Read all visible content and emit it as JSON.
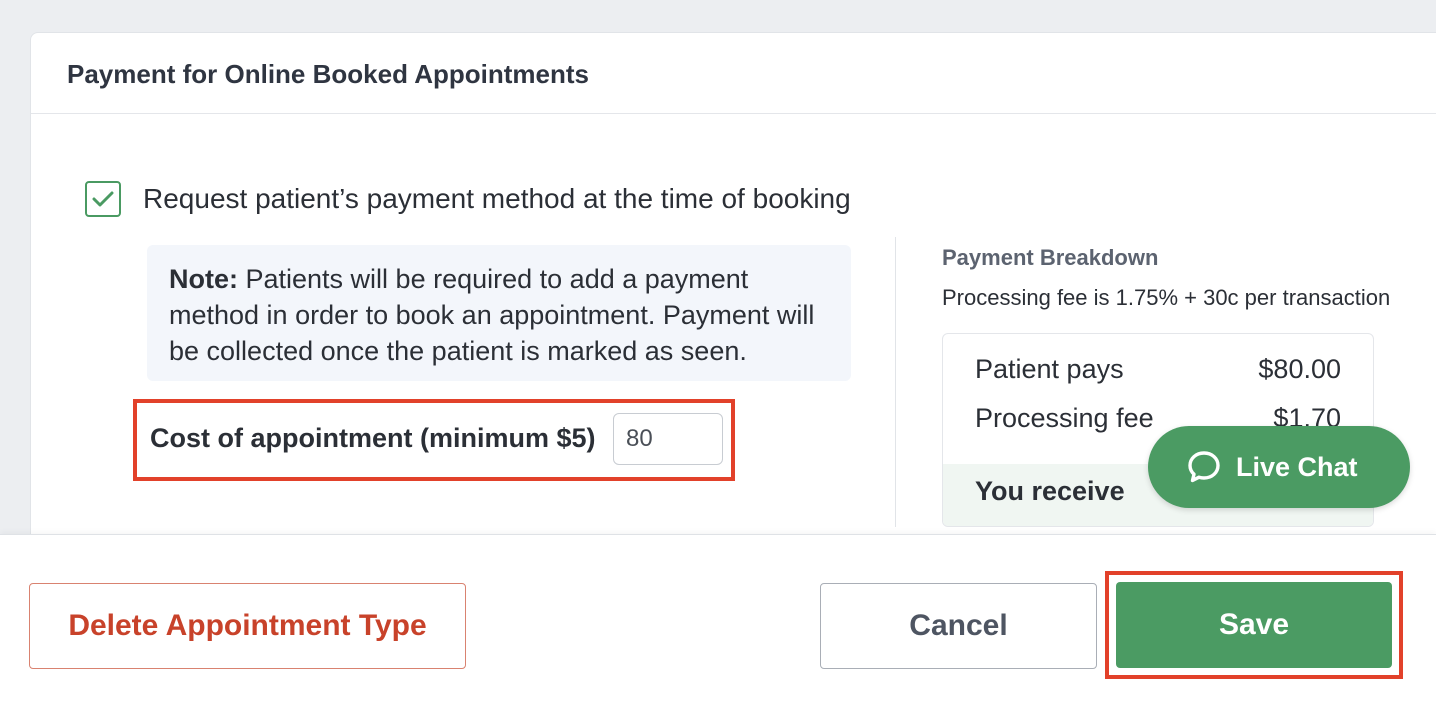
{
  "card": {
    "title": "Payment for Online Booked Appointments"
  },
  "payment_request": {
    "checked": true,
    "label": "Request patient’s payment method at the time of booking"
  },
  "note": {
    "prefix": "Note:",
    "text": " Patients will be required to add a payment method in order to book an appointment. Payment will be collected once the patient is marked as seen."
  },
  "cost": {
    "label": "Cost of appointment (minimum $5)",
    "value": "80"
  },
  "breakdown": {
    "title": "Payment Breakdown",
    "subtitle": "Processing fee is 1.75% + 30c per transaction",
    "rows": [
      {
        "label": "Patient pays",
        "value": "$80.00"
      },
      {
        "label": "Processing fee",
        "value": "$1.70"
      }
    ],
    "total_label": "You receive"
  },
  "live_chat": {
    "label": "Live Chat",
    "icon": "chat-bubble-icon"
  },
  "footer": {
    "delete_label": "Delete Appointment Type",
    "cancel_label": "Cancel",
    "save_label": "Save"
  },
  "colors": {
    "primary_green": "#4b9b63",
    "danger_red": "#c8422a",
    "highlight_red": "#e2412a"
  }
}
